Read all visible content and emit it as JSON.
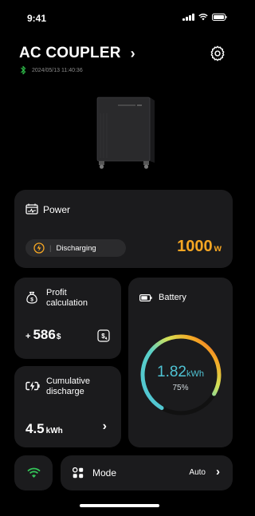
{
  "status_bar": {
    "time": "9:41"
  },
  "header": {
    "title": "AC COUPLER",
    "chevron": "›",
    "timestamp": "2024/05/13 11:40:36"
  },
  "icons": {
    "bluetooth": "bluetooth-icon",
    "settings": "gear-icon",
    "power": "power-chart-icon",
    "status": "sun-bolt-icon",
    "profit": "money-bag-icon",
    "profit_action": "money-bag-sync-icon",
    "discharge": "battery-bolt-icon",
    "battery": "battery-icon",
    "wifi": "wifi-icon",
    "mode": "grid-mode-icon"
  },
  "colors": {
    "accent_orange": "#f5a623",
    "bluetooth_green": "#2fbf4a",
    "gauge_teal": "#4fc3d4",
    "wifi_green": "#34c759"
  },
  "power": {
    "title": "Power",
    "status": "Discharging",
    "value": "1000",
    "unit": "w"
  },
  "profit": {
    "title": "Profit calculation",
    "prefix": "+",
    "value": "586",
    "unit": "$"
  },
  "discharge": {
    "title": "Cumulative discharge",
    "value": "4.5",
    "unit": "kWh",
    "chevron": "›"
  },
  "battery": {
    "title": "Battery",
    "value": "1.82",
    "unit": "kWh",
    "percent_label": "75%",
    "level": 0.75
  },
  "mode": {
    "title": "Mode",
    "value": "Auto",
    "chevron": "›"
  }
}
